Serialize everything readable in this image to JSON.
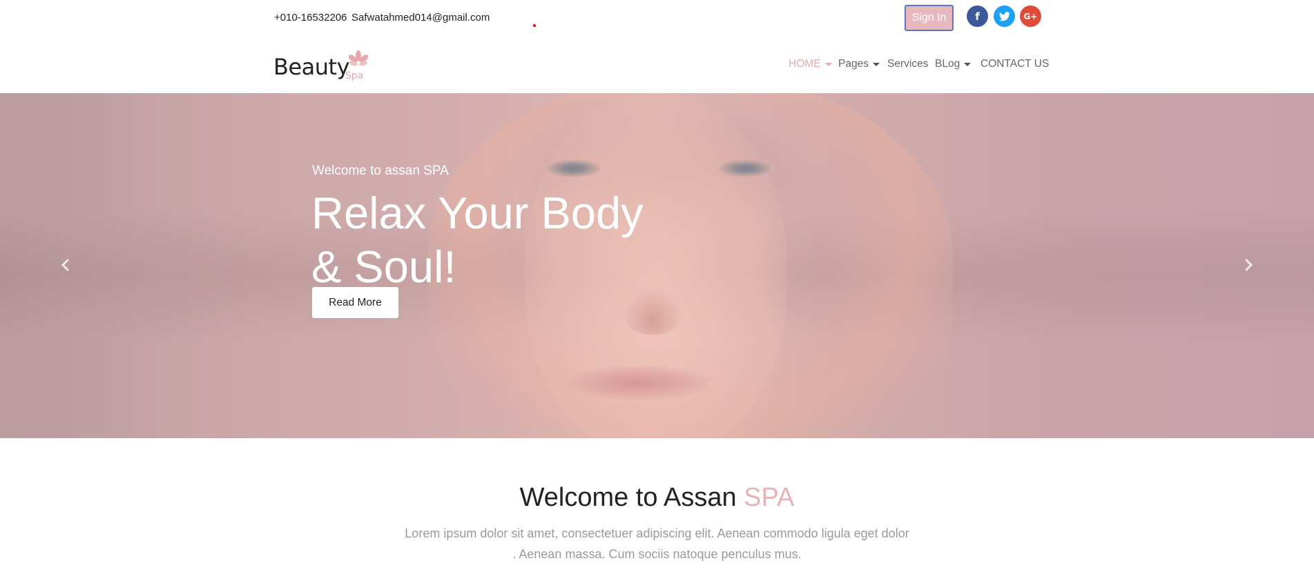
{
  "topbar": {
    "phone": "+010-16532206",
    "email": "Safwatahmed014@gmail.com",
    "signin_label": "Sign In",
    "social": [
      {
        "name": "facebook",
        "glyph": "f",
        "color": "#3b5998"
      },
      {
        "name": "twitter",
        "glyph": "t",
        "color": "#1da1f2"
      },
      {
        "name": "google-plus",
        "glyph": "G+",
        "color": "#dd4b39"
      }
    ]
  },
  "logo": {
    "word": "Beauty",
    "sub": "Spa"
  },
  "nav": {
    "items": [
      {
        "label": "HOME",
        "dropdown": true,
        "active": true
      },
      {
        "label": "Pages",
        "dropdown": true,
        "active": false
      },
      {
        "label": "Services",
        "dropdown": false,
        "active": false
      },
      {
        "label": "BLog",
        "dropdown": true,
        "active": false
      },
      {
        "label": "CONTACT US",
        "dropdown": false,
        "active": false
      }
    ]
  },
  "hero": {
    "kicker": "Welcome to assan SPA",
    "headline_line1": "Relax Your Body",
    "headline_line2": "& Soul!",
    "button_label": "Read More",
    "prev_icon": "chevron-left-icon",
    "next_icon": "chevron-right-icon"
  },
  "welcome": {
    "title_main": "Welcome to Assan ",
    "title_accent": "SPA",
    "text_line1": "Lorem ipsum dolor sit amet, consectetuer adipiscing elit. Aenean commodo ligula eget dolor",
    "text_line2": ". Aenean massa. Cum sociis natoque penculus mus."
  },
  "colors": {
    "accent": "#e7a9ae",
    "signin_bg": "#e7b9bf",
    "signin_border": "#5a76c7"
  }
}
